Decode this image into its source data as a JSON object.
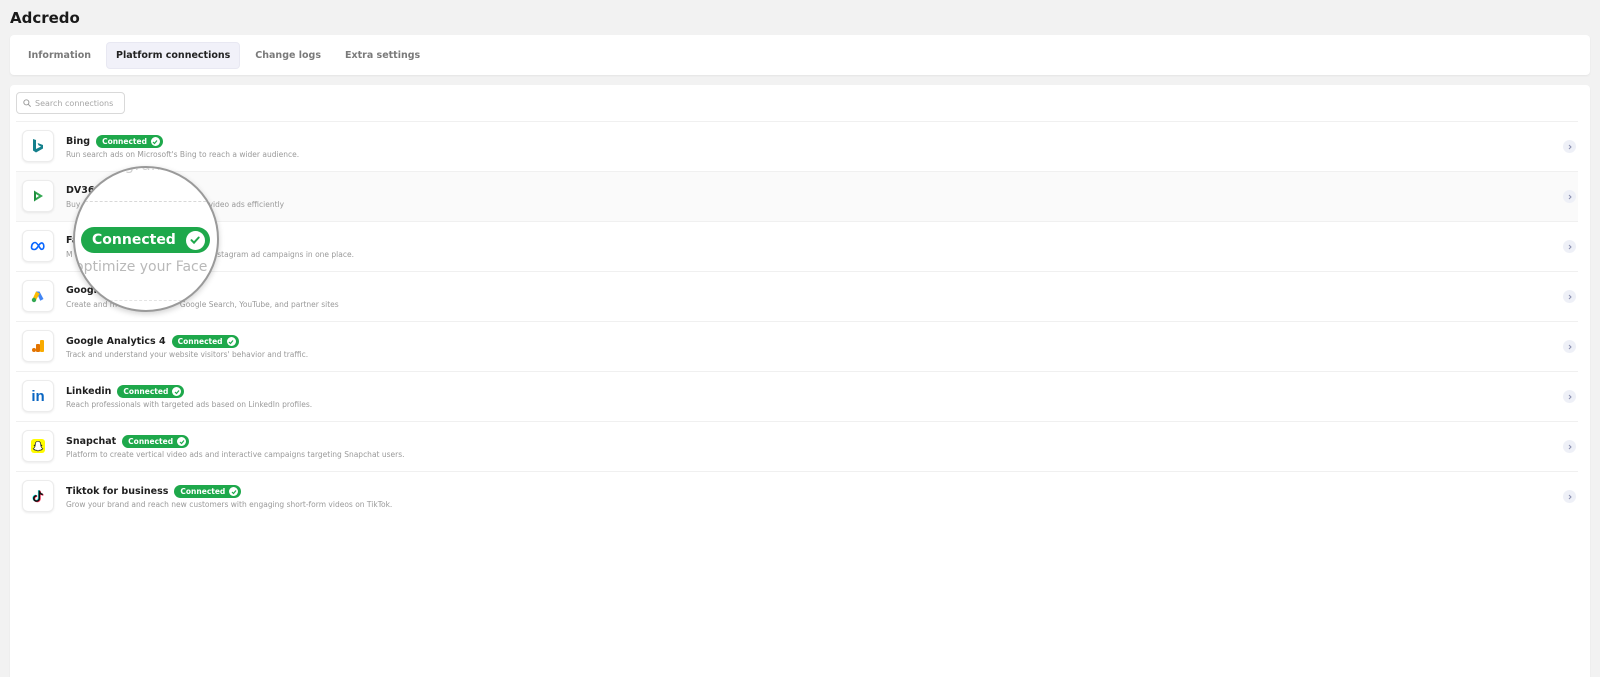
{
  "app": {
    "title": "Adcredo"
  },
  "tabs": [
    {
      "label": "Information",
      "active": false
    },
    {
      "label": "Platform connections",
      "active": true
    },
    {
      "label": "Change logs",
      "active": false
    },
    {
      "label": "Extra settings",
      "active": false
    }
  ],
  "search": {
    "placeholder": "Search connections",
    "value": ""
  },
  "connections": [
    {
      "name": "Bing",
      "status": "Connected",
      "icon": "bing-logo-icon",
      "description": "Run search ads on Microsoft's Bing to reach a wider audience."
    },
    {
      "name": "DV360",
      "status": "",
      "icon": "dv360-logo-icon",
      "description": "and video ads efficiently"
    },
    {
      "name": "Fa",
      "status": "",
      "icon": "meta-logo-icon",
      "description": "stagram ad campaigns in one place."
    },
    {
      "name": "Google",
      "status": "",
      "icon": "google-ads-logo-icon",
      "description": "Google Search, YouTube, and partner sites"
    },
    {
      "name": "Google Analytics 4",
      "status": "Connected",
      "icon": "google-analytics-logo-icon",
      "description": "Track and understand your website visitors' behavior and traffic."
    },
    {
      "name": "Linkedin",
      "status": "Connected",
      "icon": "linkedin-logo-icon",
      "description": "Reach professionals with targeted ads based on LinkedIn profiles."
    },
    {
      "name": "Snapchat",
      "status": "Connected",
      "icon": "snapchat-logo-icon",
      "description": "Platform to create vertical video ads and interactive campaigns targeting Snapchat users."
    },
    {
      "name": "Tiktok for business",
      "status": "Connected",
      "icon": "tiktok-logo-icon",
      "description": "Grow your brand and reach new customers with engaging short-form videos on TikTok."
    }
  ],
  "desc_prefix": {
    "dv360": "Buy",
    "facebook": "M",
    "google": "Create and m"
  },
  "magnifier": {
    "badge_label": "Connected",
    "top_fragment": "ogran",
    "desc_fragment": "optimize your Face"
  },
  "colors": {
    "connected_green": "#1ea84b",
    "background": "#f2f2f2",
    "active_tab_bg": "#f1f1f9"
  }
}
